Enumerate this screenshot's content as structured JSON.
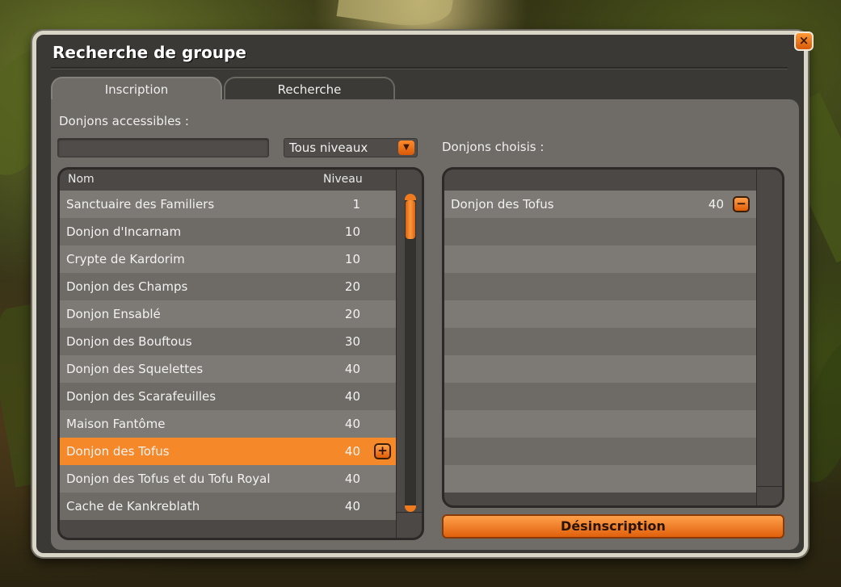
{
  "window": {
    "title": "Recherche de groupe",
    "close_icon": "×"
  },
  "tabs": [
    {
      "label": "Inscription",
      "active": true
    },
    {
      "label": "Recherche",
      "active": false
    }
  ],
  "left": {
    "section_label": "Donjons accessibles :",
    "search_value": "",
    "level_filter": "Tous niveaux",
    "columns": {
      "name": "Nom",
      "level": "Niveau"
    },
    "dungeons": [
      {
        "name": "Sanctuaire des Familiers",
        "level": "1"
      },
      {
        "name": "Donjon d'Incarnam",
        "level": "10"
      },
      {
        "name": "Crypte de Kardorim",
        "level": "10"
      },
      {
        "name": "Donjon des Champs",
        "level": "20"
      },
      {
        "name": "Donjon Ensablé",
        "level": "20"
      },
      {
        "name": "Donjon des Bouftous",
        "level": "30"
      },
      {
        "name": "Donjon des Squelettes",
        "level": "40"
      },
      {
        "name": "Donjon des Scarafeuilles",
        "level": "40"
      },
      {
        "name": "Maison Fantôme",
        "level": "40"
      },
      {
        "name": "Donjon des Tofus",
        "level": "40",
        "selected": true,
        "action": "+"
      },
      {
        "name": "Donjon des Tofus et du Tofu Royal",
        "level": "40"
      },
      {
        "name": "Cache de Kankreblath",
        "level": "40"
      }
    ]
  },
  "right": {
    "section_label": "Donjons choisis :",
    "chosen": [
      {
        "name": "Donjon des Tofus",
        "level": "40",
        "action": "−"
      }
    ],
    "empty_rows": 10,
    "unsubscribe_label": "Désinscription"
  },
  "colors": {
    "accent": "#f5892a",
    "panel": "#6f6b66",
    "frame": "#d9d6c8",
    "row_light": "#7d7975",
    "row_dark": "#6e6a66"
  }
}
